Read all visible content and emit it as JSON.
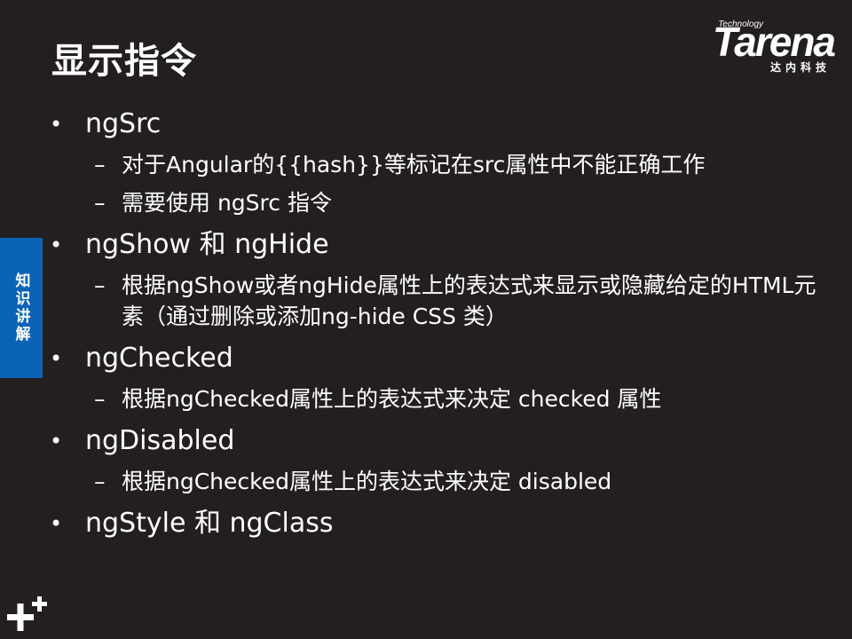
{
  "title": "显示指令",
  "logo": {
    "tech": "Technology",
    "word": "Tarena",
    "cn": "达内科技"
  },
  "side_tab": "知识讲解",
  "items": [
    {
      "label": "ngSrc",
      "subs": [
        "对于Angular的{{hash}}等标记在src属性中不能正确工作",
        "需要使用 ngSrc 指令"
      ]
    },
    {
      "label": "ngShow 和 ngHide",
      "subs": [
        "根据ngShow或者ngHide属性上的表达式来显示或隐藏给定的HTML元素（通过删除或添加ng-hide  CSS 类）"
      ]
    },
    {
      "label": "ngChecked",
      "subs": [
        "根据ngChecked属性上的表达式来决定  checked 属性"
      ]
    },
    {
      "label": "ngDisabled",
      "subs": [
        "根据ngChecked属性上的表达式来决定  disabled"
      ]
    },
    {
      "label": "ngStyle 和 ngClass",
      "subs": []
    }
  ]
}
